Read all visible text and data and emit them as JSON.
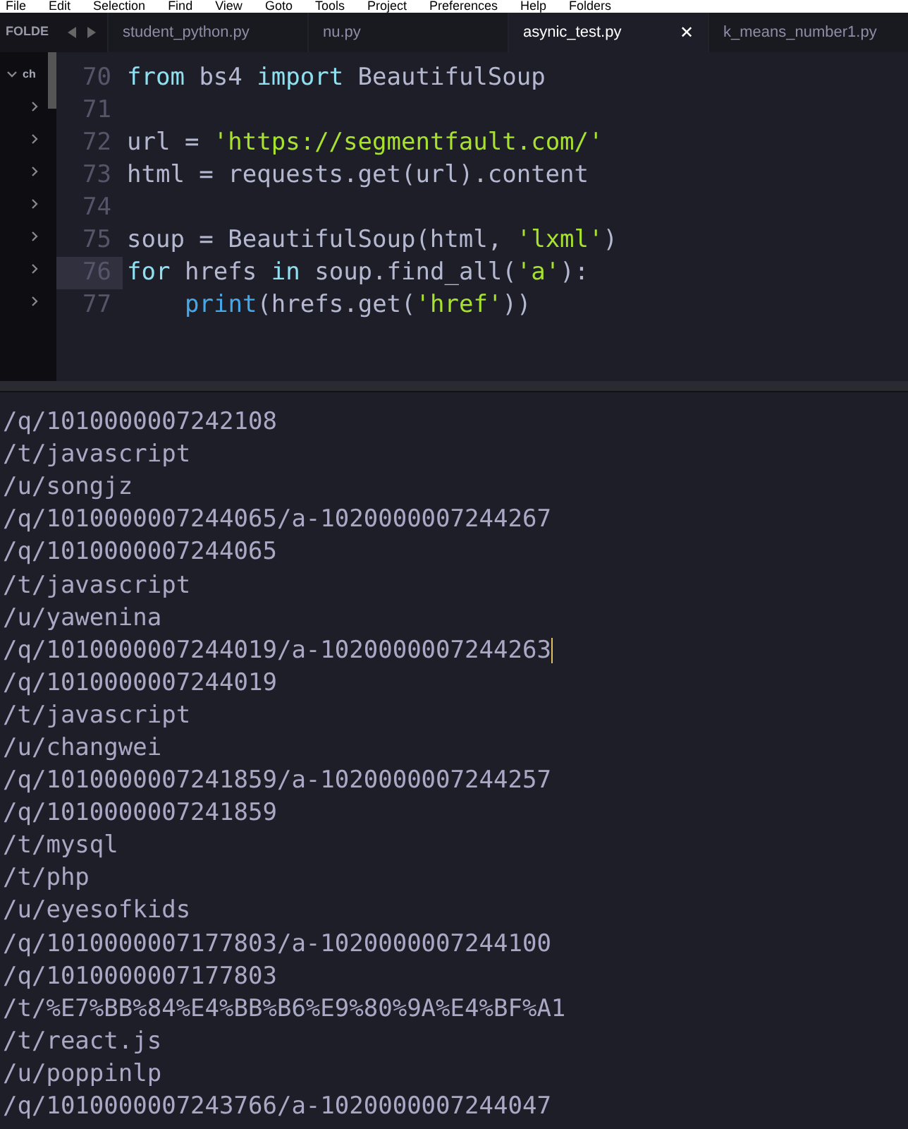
{
  "menu_bar": [
    "File",
    "Edit",
    "Selection",
    "Find",
    "View",
    "Goto",
    "Tools",
    "Project",
    "Preferences",
    "Help",
    "Folders"
  ],
  "sidebar": {
    "header": "FOLDE",
    "items": [
      {
        "label": "ch",
        "expanded": true
      },
      {
        "expanded": false
      },
      {
        "expanded": false
      },
      {
        "expanded": false
      },
      {
        "expanded": false
      },
      {
        "expanded": false
      },
      {
        "expanded": false
      },
      {
        "expanded": false
      }
    ]
  },
  "tabs": [
    {
      "label": "student_python.py",
      "selected": false
    },
    {
      "label": "nu.py",
      "selected": false
    },
    {
      "label": "asynic_test.py",
      "selected": true,
      "close": "✕"
    },
    {
      "label": "k_means_number1.py",
      "selected": false
    }
  ],
  "editor": {
    "lines": [
      {
        "number": "70",
        "current": false,
        "tokens": [
          {
            "text": "from",
            "kind": "keyword"
          },
          {
            "text": " bs4 ",
            "kind": "plain"
          },
          {
            "text": "import",
            "kind": "keyword"
          },
          {
            "text": " BeautifulSoup",
            "kind": "plain"
          }
        ]
      },
      {
        "number": "71",
        "current": false
      },
      {
        "number": "72",
        "current": false,
        "tokens": [
          {
            "text": "url = ",
            "kind": "plain"
          },
          {
            "text": "'https://segmentfault.com/'",
            "kind": "string"
          }
        ]
      },
      {
        "number": "73",
        "current": false,
        "tokens": [
          {
            "text": "html = requests.get(url).content",
            "kind": "plain"
          }
        ]
      },
      {
        "number": "74",
        "current": false
      },
      {
        "number": "75",
        "current": false,
        "tokens": [
          {
            "text": "soup = BeautifulSoup(html, ",
            "kind": "plain"
          },
          {
            "text": "'lxml'",
            "kind": "string"
          },
          {
            "text": ")",
            "kind": "plain"
          }
        ]
      },
      {
        "number": "76",
        "current": true,
        "tokens": [
          {
            "text": "for",
            "kind": "keyword"
          },
          {
            "text": " hrefs ",
            "kind": "plain"
          },
          {
            "text": "in",
            "kind": "keyword"
          },
          {
            "text": " soup.find_all(",
            "kind": "plain"
          },
          {
            "text": "'a'",
            "kind": "string"
          },
          {
            "text": "):",
            "kind": "plain"
          }
        ]
      },
      {
        "number": "77",
        "current": false,
        "indented": true,
        "tokens": [
          {
            "text": "print",
            "kind": "builtin"
          },
          {
            "text": "(hrefs.get(",
            "kind": "plain"
          },
          {
            "text": "'href'",
            "kind": "string"
          },
          {
            "text": "))",
            "kind": "plain"
          }
        ]
      }
    ]
  },
  "output": {
    "lines": [
      {
        "text": "/q/1010000007242108",
        "cursor": false
      },
      {
        "text": "/t/javascript",
        "cursor": false
      },
      {
        "text": "/u/songjz",
        "cursor": false
      },
      {
        "text": "/q/1010000007244065/a-1020000007244267",
        "cursor": false
      },
      {
        "text": "/q/1010000007244065",
        "cursor": false
      },
      {
        "text": "/t/javascript",
        "cursor": false
      },
      {
        "text": "/u/yawenina",
        "cursor": false
      },
      {
        "text": "/q/1010000007244019/a-1020000007244263",
        "cursor": true
      },
      {
        "text": "/q/1010000007244019",
        "cursor": false
      },
      {
        "text": "/t/javascript",
        "cursor": false
      },
      {
        "text": "/u/changwei",
        "cursor": false
      },
      {
        "text": "/q/1010000007241859/a-1020000007244257",
        "cursor": false
      },
      {
        "text": "/q/1010000007241859",
        "cursor": false
      },
      {
        "text": "/t/mysql",
        "cursor": false
      },
      {
        "text": "/t/php",
        "cursor": false
      },
      {
        "text": "/u/eyesofkids",
        "cursor": false
      },
      {
        "text": "/q/1010000007177803/a-1020000007244100",
        "cursor": false
      },
      {
        "text": "/q/1010000007177803",
        "cursor": false
      },
      {
        "text": "/t/%E7%BB%84%E4%BB%B6%E9%80%9A%E4%BF%A1",
        "cursor": false
      },
      {
        "text": "/t/react.js",
        "cursor": false
      },
      {
        "text": "/u/poppinlp",
        "cursor": false
      },
      {
        "text": "/q/1010000007243766/a-1020000007244047",
        "cursor": false
      }
    ]
  }
}
